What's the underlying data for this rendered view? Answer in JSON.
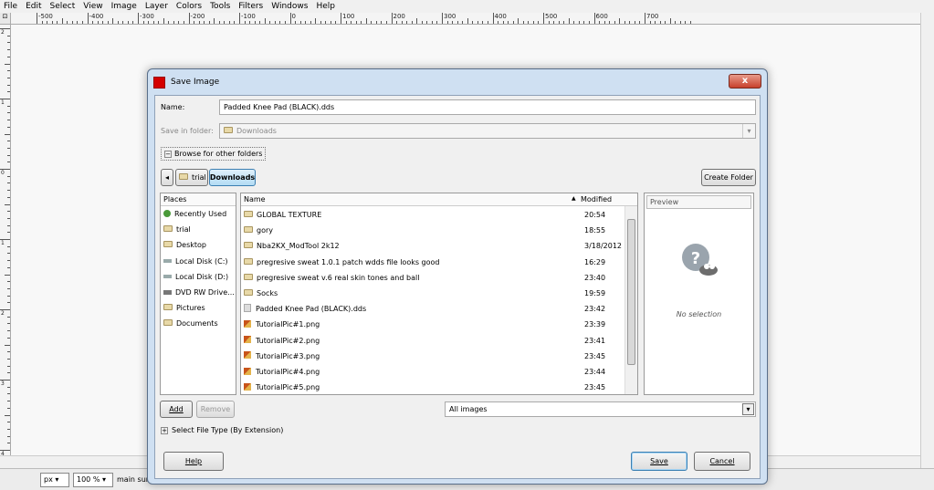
{
  "menubar": [
    "File",
    "Edit",
    "Select",
    "View",
    "Image",
    "Layer",
    "Colors",
    "Tools",
    "Filters",
    "Windows",
    "Help"
  ],
  "ruler_labels": [
    "-500",
    "-400",
    "-300",
    "-200",
    "-100",
    "0",
    "100",
    "200",
    "300",
    "400",
    "500",
    "600",
    "700"
  ],
  "vruler_labels": [
    "2",
    "1",
    "0",
    "1",
    "2",
    "3",
    "4"
  ],
  "statusbar": {
    "unit": "px",
    "zoom": "100 %",
    "message": "main surf"
  },
  "dialog": {
    "title": "Save Image",
    "close_label": "x",
    "name_label": "Name:",
    "name_value": "Padded Knee Pad (BLACK).dds",
    "save_in_label": "Save in folder:",
    "save_in_value": "Downloads",
    "browse_label": "Browse for other folders",
    "crumbs": [
      "trial",
      "Downloads"
    ],
    "create_folder": "Create Folder",
    "places_header": "Places",
    "places": [
      {
        "label": "Recently Used",
        "icon": "clock-icon"
      },
      {
        "label": "trial",
        "icon": "folder-icon"
      },
      {
        "label": "Desktop",
        "icon": "folder-icon"
      },
      {
        "label": "Local Disk (C:)",
        "icon": "drive-icon"
      },
      {
        "label": "Local Disk (D:)",
        "icon": "drive-icon"
      },
      {
        "label": "DVD RW Drive...",
        "icon": "dvd-icon"
      },
      {
        "label": "Pictures",
        "icon": "folder-icon"
      },
      {
        "label": "Documents",
        "icon": "folder-icon"
      }
    ],
    "col_name": "Name",
    "col_modified": "Modified",
    "sort_indicator": "▲",
    "files": [
      {
        "name": "GLOBAL TEXTURE",
        "modified": "20:54",
        "kind": "folder"
      },
      {
        "name": "gory",
        "modified": "18:55",
        "kind": "folder"
      },
      {
        "name": "Nba2KX_ModTool 2k12",
        "modified": "3/18/2012",
        "kind": "folder"
      },
      {
        "name": "pregresive sweat 1.0.1 patch wdds file looks good",
        "modified": "16:29",
        "kind": "folder"
      },
      {
        "name": "pregresive sweat v.6 real skin tones and ball",
        "modified": "23:40",
        "kind": "folder"
      },
      {
        "name": "Socks",
        "modified": "19:59",
        "kind": "folder"
      },
      {
        "name": "Padded Knee Pad (BLACK).dds",
        "modified": "23:42",
        "kind": "file"
      },
      {
        "name": "TutorialPic#1.png",
        "modified": "23:39",
        "kind": "image"
      },
      {
        "name": "TutorialPic#2.png",
        "modified": "23:41",
        "kind": "image"
      },
      {
        "name": "TutorialPic#3.png",
        "modified": "23:45",
        "kind": "image"
      },
      {
        "name": "TutorialPic#4.png",
        "modified": "23:44",
        "kind": "image"
      },
      {
        "name": "TutorialPic#5.png",
        "modified": "23:45",
        "kind": "image"
      }
    ],
    "preview_header": "Preview",
    "no_selection": "No selection",
    "add": "Add",
    "remove": "Remove",
    "filter_value": "All images",
    "select_type": "Select File Type (By Extension)",
    "help": "Help",
    "save": "Save",
    "cancel": "Cancel"
  }
}
